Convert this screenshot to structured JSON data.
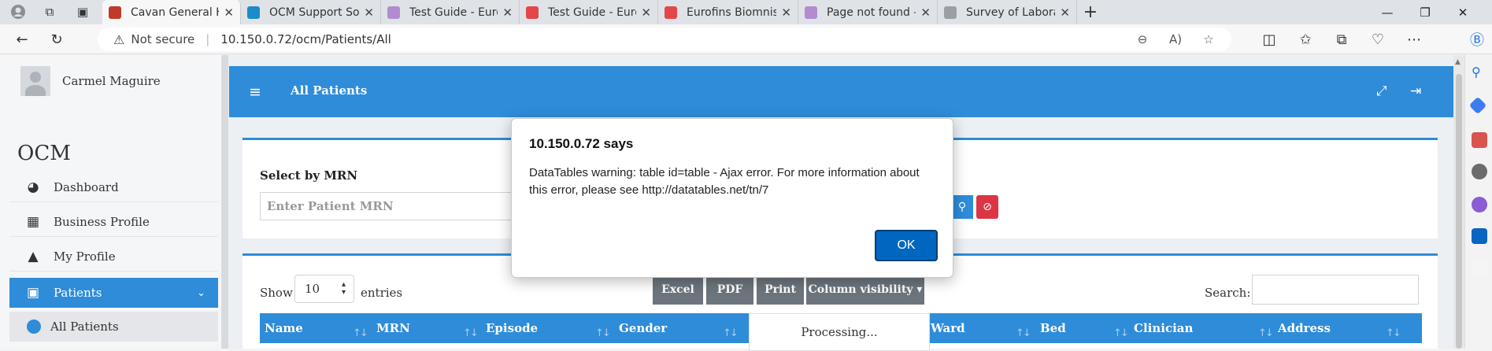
{
  "browser": {
    "tabs": [
      {
        "label": "Cavan General Hosp",
        "favicon_color": "#c0392b",
        "active": true
      },
      {
        "label": "OCM Support Softw",
        "favicon_color": "#1a8cc7",
        "active": false
      },
      {
        "label": "Test Guide - Eurofin",
        "favicon_color": "#b38bd1",
        "active": false
      },
      {
        "label": "Test Guide - Eurofin",
        "favicon_color": "#e3474a",
        "active": false
      },
      {
        "label": "Eurofins Biomnis",
        "favicon_color": "#e3474a",
        "active": false
      },
      {
        "label": "Page not found – Eu",
        "favicon_color": "#b38bd1",
        "active": false
      },
      {
        "label": "Survey of Laborator",
        "favicon_color": "#9aa0a6",
        "active": false
      }
    ],
    "tab_close": "✕",
    "new_tab": "+",
    "not_secure": "Not secure",
    "url": "10.150.0.72/ocm/Patients/All"
  },
  "sidebar": {
    "user_name": "Carmel Maguire",
    "brand": "OCM",
    "items": [
      {
        "label": "Dashboard",
        "icon": "◕"
      },
      {
        "label": "Business Profile",
        "icon": "▦"
      },
      {
        "label": "My Profile",
        "icon": "▲"
      },
      {
        "label": "Patients",
        "icon": "▣",
        "chevron": "⌄"
      }
    ],
    "sub_item": "All Patients"
  },
  "header": {
    "menu_icon": "≡",
    "title": "All Patients",
    "expand_icon": "⤢",
    "logout_icon": "⇥"
  },
  "filter": {
    "label": "Select by MRN",
    "placeholder": "Enter Patient MRN",
    "search_icon": "⚲",
    "clear_icon": "⊘"
  },
  "table": {
    "show_label": "Show",
    "page_size": "10",
    "entries_label": "entries",
    "buttons": [
      "Excel",
      "PDF",
      "Print",
      "Column visibility ▾"
    ],
    "search_label": "Search:",
    "columns": [
      "Name",
      "MRN",
      "Episode",
      "Gender",
      "Ward",
      "Bed",
      "Clinician",
      "Address"
    ],
    "processing": "Processing..."
  },
  "dialog": {
    "title": "10.150.0.72 says",
    "message": "DataTables warning: table id=table - Ajax error. For more information about this error, please see http://datatables.net/tn/7",
    "ok_label": "OK"
  }
}
